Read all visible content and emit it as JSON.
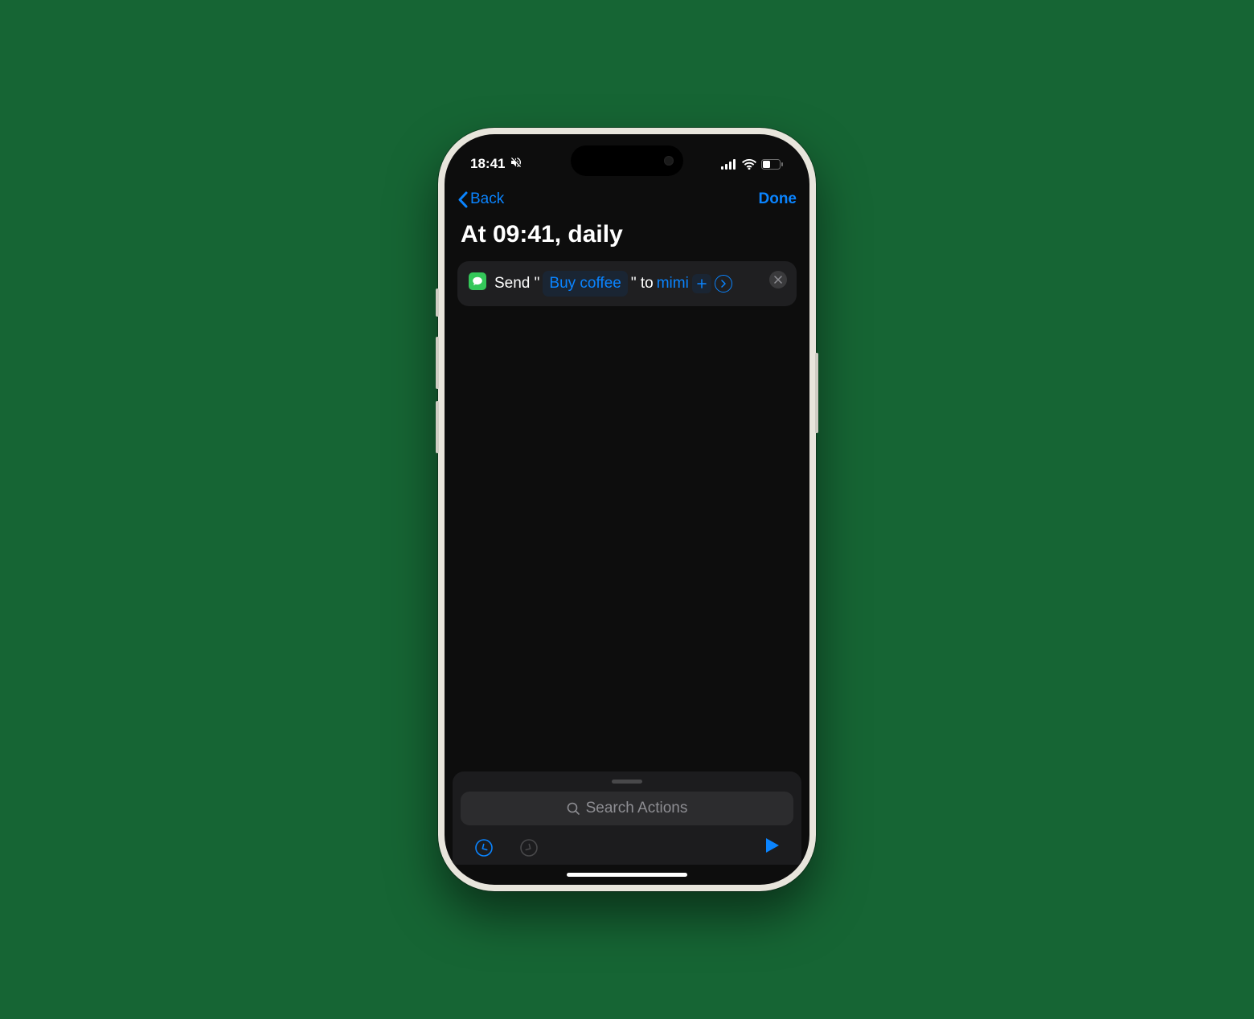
{
  "status_bar": {
    "time": "18:41"
  },
  "nav": {
    "back_label": "Back",
    "done_label": "Done"
  },
  "page_title": "At 09:41, daily",
  "action": {
    "verb_pre": "Send \"",
    "message_param": "Buy coffee",
    "verb_mid": "\" to",
    "recipient_param": "mimi"
  },
  "search": {
    "placeholder": "Search Actions"
  }
}
